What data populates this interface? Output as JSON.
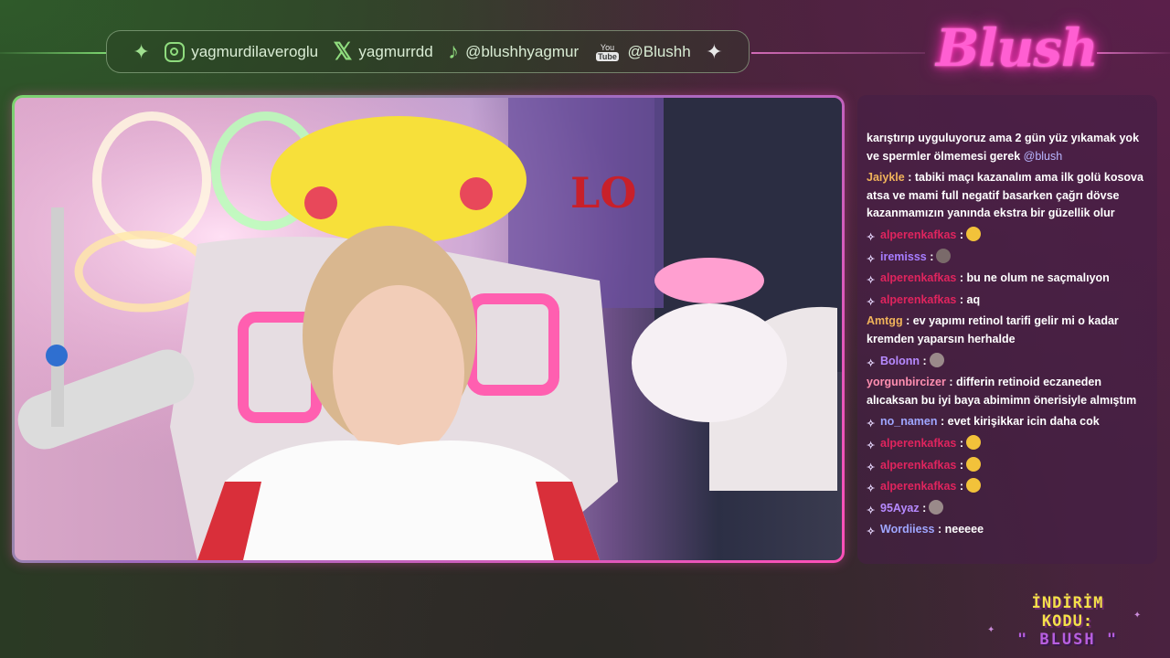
{
  "social": {
    "instagram": "yagmurdilaveroglu",
    "x": "yagmurrdd",
    "tiktok": "@blushhyagmur",
    "youtube": "@Blushh",
    "youtube_icon_top": "You",
    "youtube_icon_bottom": "Tube"
  },
  "logo": {
    "text": "Blush"
  },
  "chat": {
    "messages": [
      {
        "user": "",
        "text": "karıştırıp uyguluyoruz ama 2 gün yüz yıkamak yok ve spermler ölmemesi gerek",
        "mention": "@blush"
      },
      {
        "user": "Jaiykle",
        "color": "#f0b35a",
        "text": ": tabiki maçı kazanalım ama ilk golü kosova atsa ve mami full negatif basarken çağrı dövse kazanmamızın yanında ekstra bir güzellik olur"
      },
      {
        "user": "alperenkafkas",
        "color": "#e0245e",
        "text": ":",
        "emote": "facepalm-emote"
      },
      {
        "user": "iremisss",
        "color": "#a77dff",
        "text": ":",
        "emote": "avatar-emote"
      },
      {
        "user": "alperenkafkas",
        "color": "#e0245e",
        "text": ": bu ne olum ne saçmalıyon"
      },
      {
        "user": "alperenkafkas",
        "color": "#e0245e",
        "text": ": aq"
      },
      {
        "user": "Amtgg",
        "color": "#f0b35a",
        "text": ": ev yapımı retinol tarifi gelir mi o kadar kremden yaparsın herhalde"
      },
      {
        "user": "Bolonn",
        "color": "#b68aff",
        "text": ":",
        "emote": "face-emote"
      },
      {
        "user": "yorgunbircizer",
        "color": "#ff8fb0",
        "text": ": differin retinoid eczaneden alıcaksan bu iyi baya abimimn önerisiyle almıştım"
      },
      {
        "user": "no_namen",
        "color": "#9fa6ff",
        "text": ": evet kirişikkar icin daha cok"
      },
      {
        "user": "alperenkafkas",
        "color": "#e0245e",
        "text": ":",
        "emote": "facepalm-emote"
      },
      {
        "user": "alperenkafkas",
        "color": "#e0245e",
        "text": ":",
        "emote": "facepalm-emote"
      },
      {
        "user": "alperenkafkas",
        "color": "#e0245e",
        "text": ":",
        "emote": "facepalm-emote"
      },
      {
        "user": "95Ayaz",
        "color": "#b68aff",
        "text": ":",
        "emote": "face-emote"
      },
      {
        "user": "Wordiiess",
        "color": "#9fa6ff",
        "text": ": neeeee"
      }
    ]
  },
  "discount": {
    "line1": "İNDİRİM KODU:",
    "line2": "\" BLUSH \""
  },
  "colors": {
    "accent_green": "#7bd46f",
    "accent_pink": "#ff4fb8",
    "chat_bg": "#461e46"
  }
}
